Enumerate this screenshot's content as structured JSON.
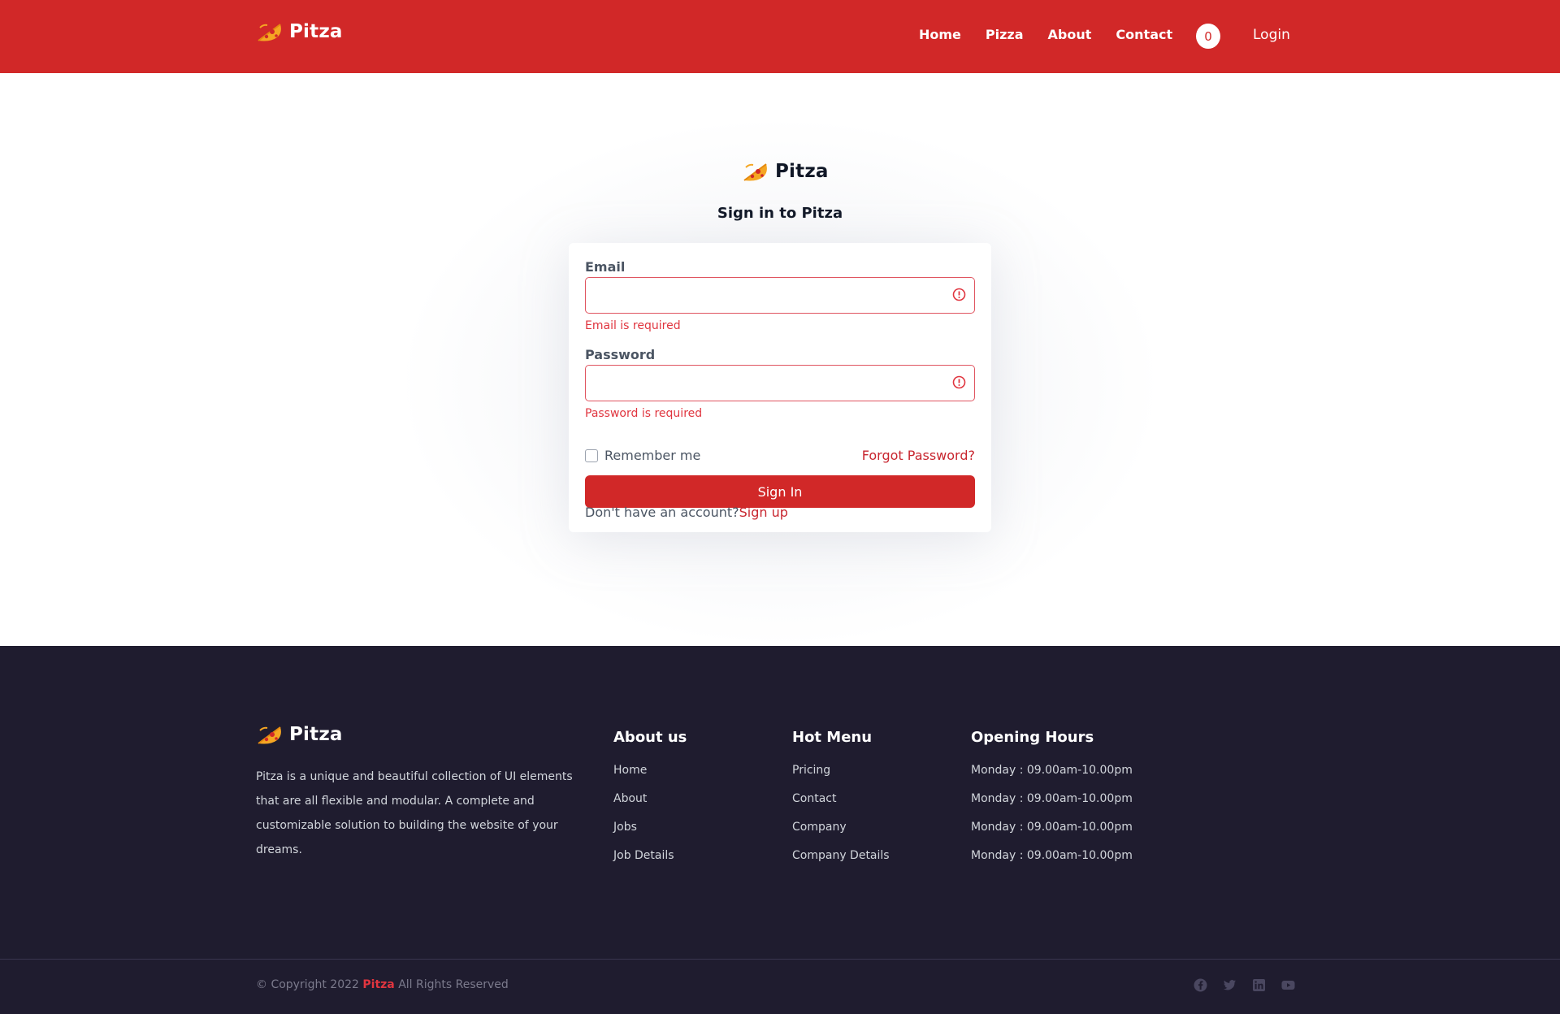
{
  "header": {
    "brand": "Pitza",
    "nav": [
      "Home",
      "Pizza",
      "About",
      "Contact"
    ],
    "cart_count": "0",
    "login": "Login"
  },
  "signin": {
    "brand": "Pitza",
    "title": "Sign in to Pitza",
    "email_label": "Email",
    "email_value": "",
    "email_error": "Email is required",
    "password_label": "Password",
    "password_value": "",
    "password_error": "Password is required",
    "remember_label": "Remember me",
    "remember_checked": false,
    "forgot": "Forgot Password?",
    "submit": "Sign In",
    "no_account": "Don't have an account?",
    "signup": "Sign up"
  },
  "footer": {
    "brand": "Pitza",
    "description": "Pitza is a unique and beautiful collection of UI elements that are all flexible and modular. A complete and customizable solution to building the website of your dreams.",
    "columns": [
      {
        "title": "About us",
        "items": [
          "Home",
          "About",
          "Jobs",
          "Job Details"
        ]
      },
      {
        "title": "Hot Menu",
        "items": [
          "Pricing",
          "Contact",
          "Company",
          "Company Details"
        ]
      },
      {
        "title": "Opening Hours",
        "items": [
          "Monday : 09.00am-10.00pm",
          "Monday : 09.00am-10.00pm",
          "Monday : 09.00am-10.00pm",
          "Monday : 09.00am-10.00pm"
        ]
      }
    ],
    "copyright_prefix": "© Copyright 2022",
    "copyright_brand": "Pitza",
    "copyright_suffix": "All Rights Reserved",
    "socials": [
      "facebook-icon",
      "twitter-icon",
      "linkedin-icon",
      "youtube-icon"
    ]
  },
  "colors": {
    "primary_red": "#d12828",
    "error_red": "#e0353f",
    "footer_bg": "#1f1c2f",
    "logo_orange": "#f5a623"
  }
}
